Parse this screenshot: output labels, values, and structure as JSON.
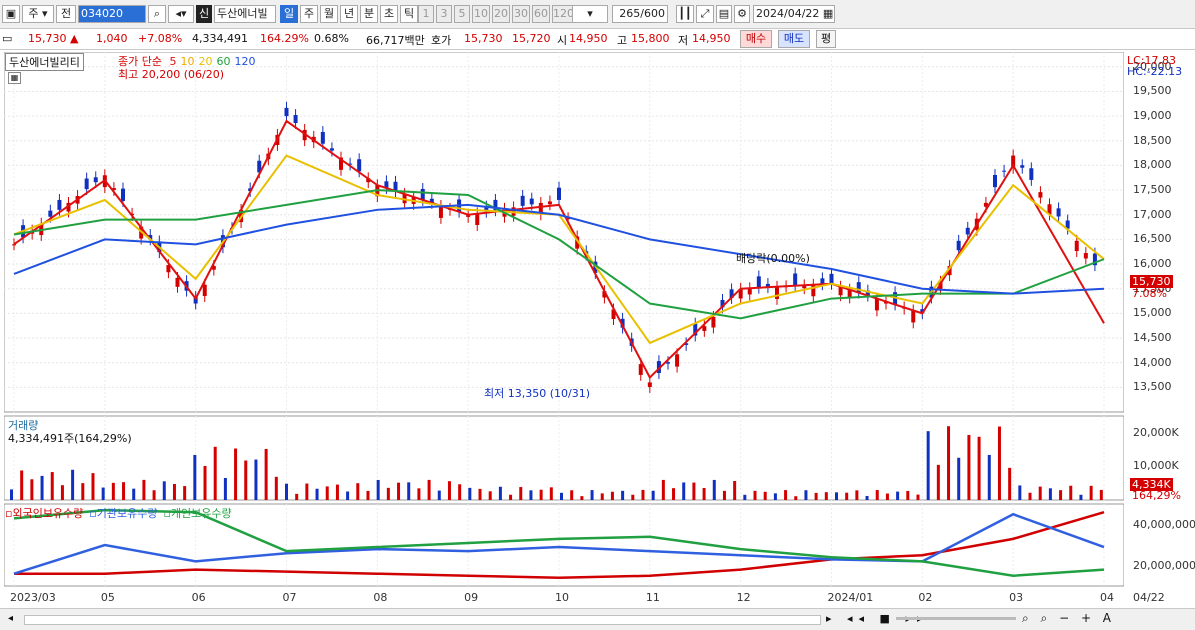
{
  "toolbar": {
    "market": "주",
    "prev_label": "전",
    "stock_code": "034020",
    "credit_badge": "신",
    "stock_name": "두산에너빌",
    "periods": [
      "일",
      "주",
      "월",
      "년",
      "분",
      "초",
      "틱"
    ],
    "active_period": "일",
    "intervals": [
      "1",
      "3",
      "5",
      "10",
      "20",
      "30",
      "60",
      "120"
    ],
    "count": "265",
    "count_max": "/600",
    "date": "2024/04/22"
  },
  "quote": {
    "price": "15,730",
    "change_arrow": "▲",
    "change": "1,040",
    "change_pct": "+7.08%",
    "volume": "4,334,491",
    "volume_ratio": "164.29%",
    "turnover_pct": "0.68%",
    "amount": "66,717백만",
    "hoga_label": "호가",
    "ask": "15,730",
    "bid": "15,720",
    "open_label": "시",
    "open": "14,950",
    "high_label": "고",
    "high": "15,800",
    "low_label": "저",
    "low": "14,950",
    "buy_button": "매수",
    "sell_button": "매도",
    "extra_button": "평"
  },
  "price_panel": {
    "name_box": "두산에너빌리티",
    "legend_prefix": "종가 단순",
    "ma_periods": [
      "5",
      "10",
      "20",
      "60",
      "120"
    ],
    "ma_colors": [
      "#e01010",
      "#f0a800",
      "#e8c000",
      "#20a040",
      "#2050e0"
    ],
    "max_label": "최고 20,200 (06/20)",
    "min_label": "최저 13,350 (10/31)",
    "dividend_label": "배당락(0.00%)",
    "lc_label": "LC:17.83",
    "hc_label": "HC:-22.13",
    "current_tag": "15,730",
    "current_pct_tag": "7.08%",
    "y_ticks": [
      "20,000",
      "19,500",
      "19,000",
      "18,500",
      "18,000",
      "17,500",
      "17,000",
      "16,500",
      "16,000",
      "15,500",
      "15,000",
      "14,500",
      "14,000",
      "13,500"
    ]
  },
  "volume_panel": {
    "title": "거래량",
    "value_label": "4,334,491주(164,29%)",
    "y_ticks": [
      "20,000K",
      "10,000K"
    ],
    "current_tag": "4,334K",
    "current_pct_tag": "164,29%"
  },
  "holding_panel": {
    "legend": [
      "외국인보유수량",
      "기관보유수량",
      "개인보유수량"
    ],
    "legend_colors": [
      "#d00000",
      "#3060e0",
      "#20a040"
    ],
    "y_ticks": [
      "40,000,000",
      "20,000,000"
    ]
  },
  "x_axis": {
    "labels": [
      "2023/03",
      "05",
      "06",
      "07",
      "08",
      "09",
      "10",
      "11",
      "12",
      "2024/01",
      "02",
      "03",
      "04"
    ],
    "last_label": "04/22"
  },
  "colors": {
    "up": "#d40000",
    "down": "#1030c0",
    "accent": "#2a6fd6"
  },
  "chart_data": {
    "type": "line",
    "x": [
      "2023/03",
      "05",
      "06",
      "07",
      "08",
      "09",
      "10",
      "11",
      "12",
      "2024/01",
      "02",
      "03",
      "04"
    ],
    "series": [
      {
        "name": "종가",
        "values": [
          16400,
          17800,
          15200,
          19000,
          17600,
          17000,
          17300,
          13600,
          15500,
          15600,
          15000,
          18200,
          15730
        ]
      },
      {
        "name": "5",
        "values": [
          16400,
          17700,
          15300,
          18900,
          17600,
          17000,
          17200,
          13700,
          15500,
          15600,
          15000,
          18000,
          14800
        ]
      },
      {
        "name": "20",
        "values": [
          16600,
          17300,
          15700,
          18200,
          17400,
          17100,
          17000,
          14400,
          15200,
          15600,
          15200,
          17600,
          16100
        ]
      },
      {
        "name": "60",
        "values": [
          16600,
          16900,
          16900,
          17200,
          17500,
          17400,
          16500,
          15200,
          14900,
          15300,
          15400,
          15400,
          16100
        ]
      },
      {
        "name": "120",
        "values": [
          15800,
          16500,
          16400,
          16800,
          17100,
          17200,
          17000,
          16500,
          16200,
          15900,
          15500,
          15400,
          15500
        ]
      }
    ],
    "ylim": [
      13000,
      20300
    ],
    "volume": {
      "values_k": [
        9000,
        6000,
        16000,
        5000,
        6000,
        4000,
        3000,
        6000,
        3000,
        3000,
        22000,
        4334
      ]
    },
    "holdings": {
      "ylim": [
        10000000,
        50000000
      ],
      "foreign": [
        16000000,
        16000000,
        18000000,
        17000000,
        16000000,
        15000000,
        14000000,
        15000000,
        18000000,
        23000000,
        25000000,
        33000000,
        46000000
      ],
      "institution": [
        16000000,
        30000000,
        22000000,
        26000000,
        28000000,
        27000000,
        29000000,
        27000000,
        25000000,
        23000000,
        22000000,
        45000000,
        29000000
      ],
      "individual": [
        43000000,
        47000000,
        46000000,
        27000000,
        29000000,
        31000000,
        33000000,
        34000000,
        28000000,
        24000000,
        22000000,
        15000000,
        18000000
      ]
    }
  }
}
